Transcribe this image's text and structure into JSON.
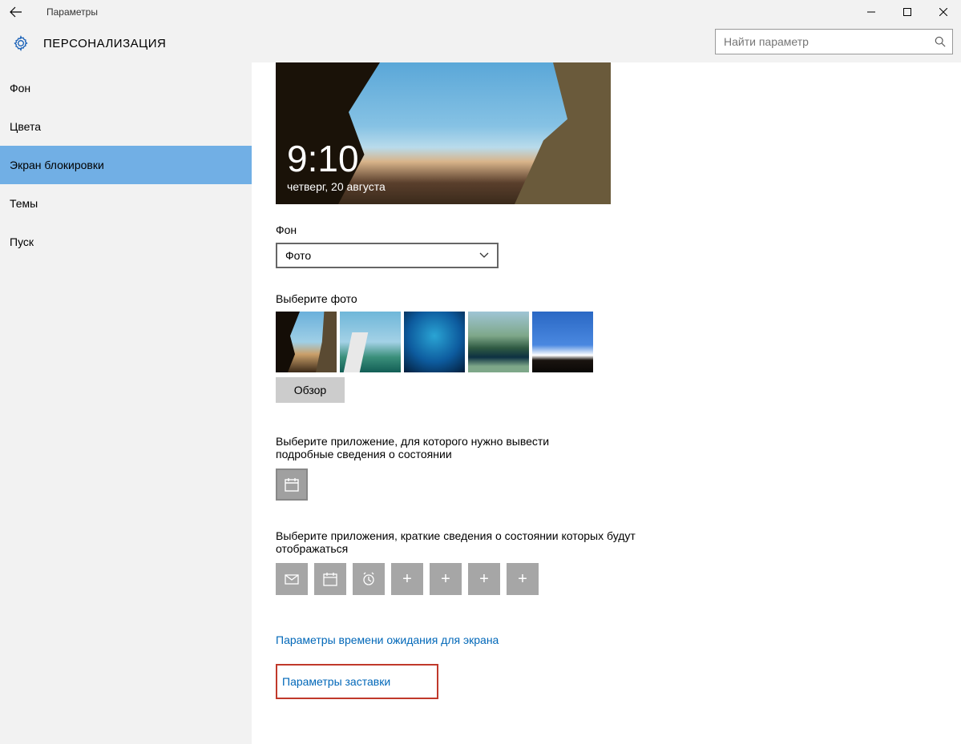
{
  "window": {
    "title": "Параметры"
  },
  "header": {
    "category": "ПЕРСОНАЛИЗАЦИЯ"
  },
  "search": {
    "placeholder": "Найти параметр"
  },
  "sidebar": {
    "items": [
      {
        "label": "Фон",
        "active": false
      },
      {
        "label": "Цвета",
        "active": false
      },
      {
        "label": "Экран блокировки",
        "active": true
      },
      {
        "label": "Темы",
        "active": false
      },
      {
        "label": "Пуск",
        "active": false
      }
    ]
  },
  "preview": {
    "time": "9:10",
    "date": "четверг, 20 августа"
  },
  "background": {
    "label": "Фон",
    "selected": "Фото"
  },
  "choose_photo": {
    "label": "Выберите фото",
    "browse": "Обзор"
  },
  "detailed_app": {
    "label": "Выберите приложение, для которого нужно вывести подробные сведения о состоянии"
  },
  "quick_apps": {
    "label": "Выберите приложения, краткие сведения о состоянии которых будут отображаться"
  },
  "links": {
    "timeout": "Параметры времени ожидания для экрана",
    "screensaver": "Параметры заставки"
  }
}
